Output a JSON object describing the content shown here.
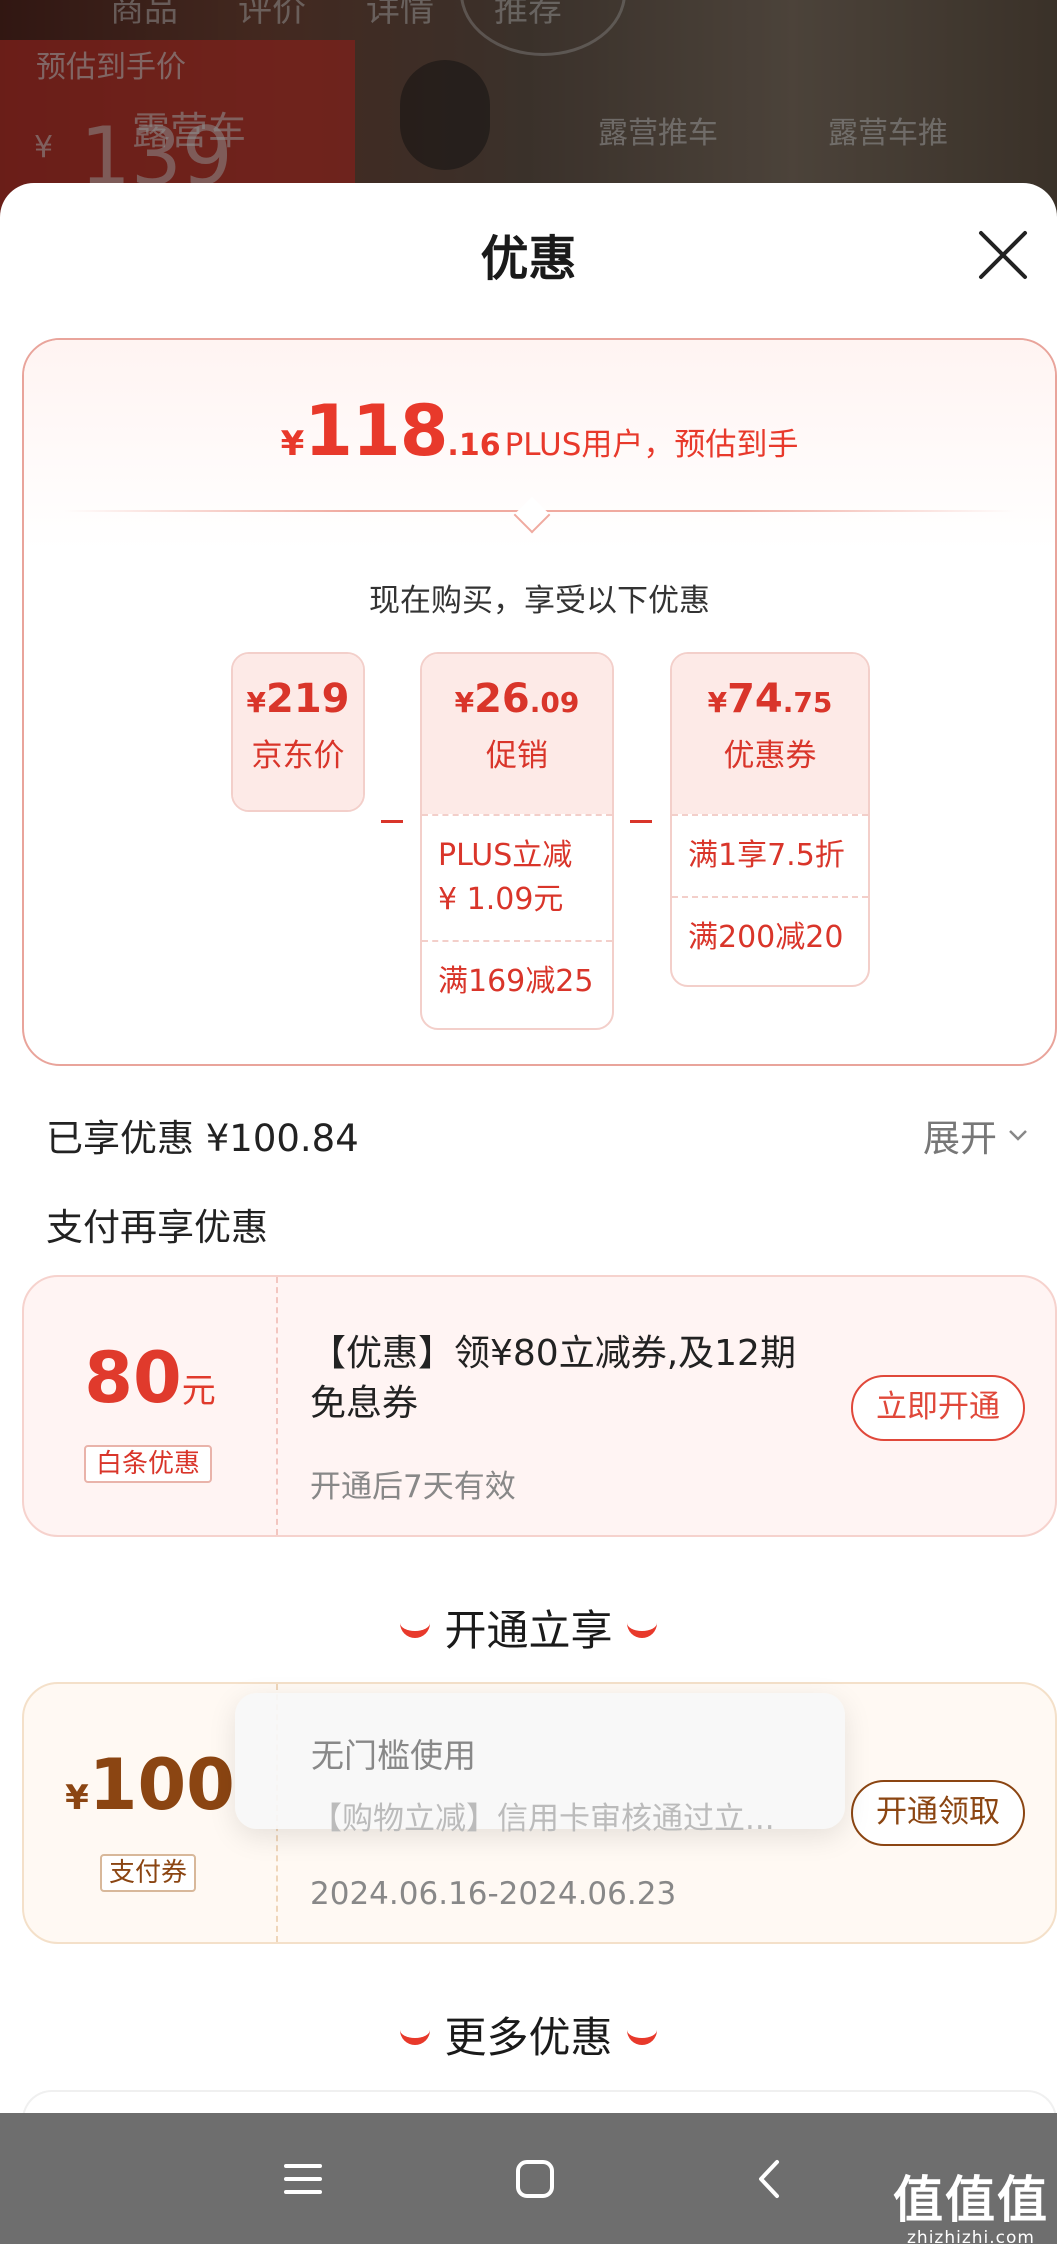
{
  "background_page": {
    "tabs": [
      "商品",
      "评价",
      "详情",
      "推荐"
    ],
    "price_label": "预估到手价",
    "yen": "¥",
    "price": "139",
    "product_name": "露营车",
    "hint_left": "露营推车",
    "hint_right": "露营车推"
  },
  "sheet": {
    "title": "优惠",
    "close_icon": "close-icon"
  },
  "summary": {
    "currency": "¥",
    "price_int": "118",
    "price_dec": ".16",
    "price_note": "PLUS用户，预估到手",
    "subtitle": "现在购买，享受以下优惠",
    "chips": [
      {
        "currency": "¥",
        "value": "219",
        "decimal": "",
        "label": "京东价",
        "details": []
      },
      {
        "currency": "¥",
        "value": "26",
        "decimal": ".09",
        "label": "促销",
        "details": [
          "PLUS立减\n¥ 1.09元",
          "满169减25"
        ]
      },
      {
        "currency": "¥",
        "value": "74",
        "decimal": ".75",
        "label": "优惠券",
        "details": [
          "满1享7.5折",
          "满200减20"
        ]
      }
    ],
    "chip_details": {
      "promo_1_line1": "PLUS立减",
      "promo_1_line2": "¥ 1.09元",
      "promo_2": "满169减25",
      "coupon_1": "满1享7.5折",
      "coupon_2": "满200减20"
    }
  },
  "enjoyed": {
    "label": "已享优惠 ¥100.84",
    "expand_label": "展开"
  },
  "pay_section_title": "支付再享优惠",
  "baitiao_card": {
    "amount": "80",
    "unit": "元",
    "tag": "白条优惠",
    "title": "【优惠】领¥80立减券,及12期免息券",
    "subtitle": "开通后7天有效",
    "button": "立即开通"
  },
  "section_open": "开通立享",
  "pay_card": {
    "currency": "¥",
    "amount": "100",
    "tag": "支付券",
    "date_range": "2024.06.16-2024.06.23",
    "button": "开通领取"
  },
  "tooltip": {
    "line1": "无门槛使用",
    "line2": "【购物立减】信用卡审核通过立..."
  },
  "section_more": "更多优惠",
  "nav": {
    "menu_icon": "menu-icon",
    "home_icon": "home-square-icon",
    "back_icon": "back-chevron-icon"
  },
  "watermark": {
    "big": "值值值",
    "small": "zhizhizhi.com"
  },
  "colors": {
    "accent_red": "#e8392b",
    "chip_bg": "#fdeae7",
    "brown": "#8b4512",
    "nav_bg": "#6e6e6e"
  }
}
